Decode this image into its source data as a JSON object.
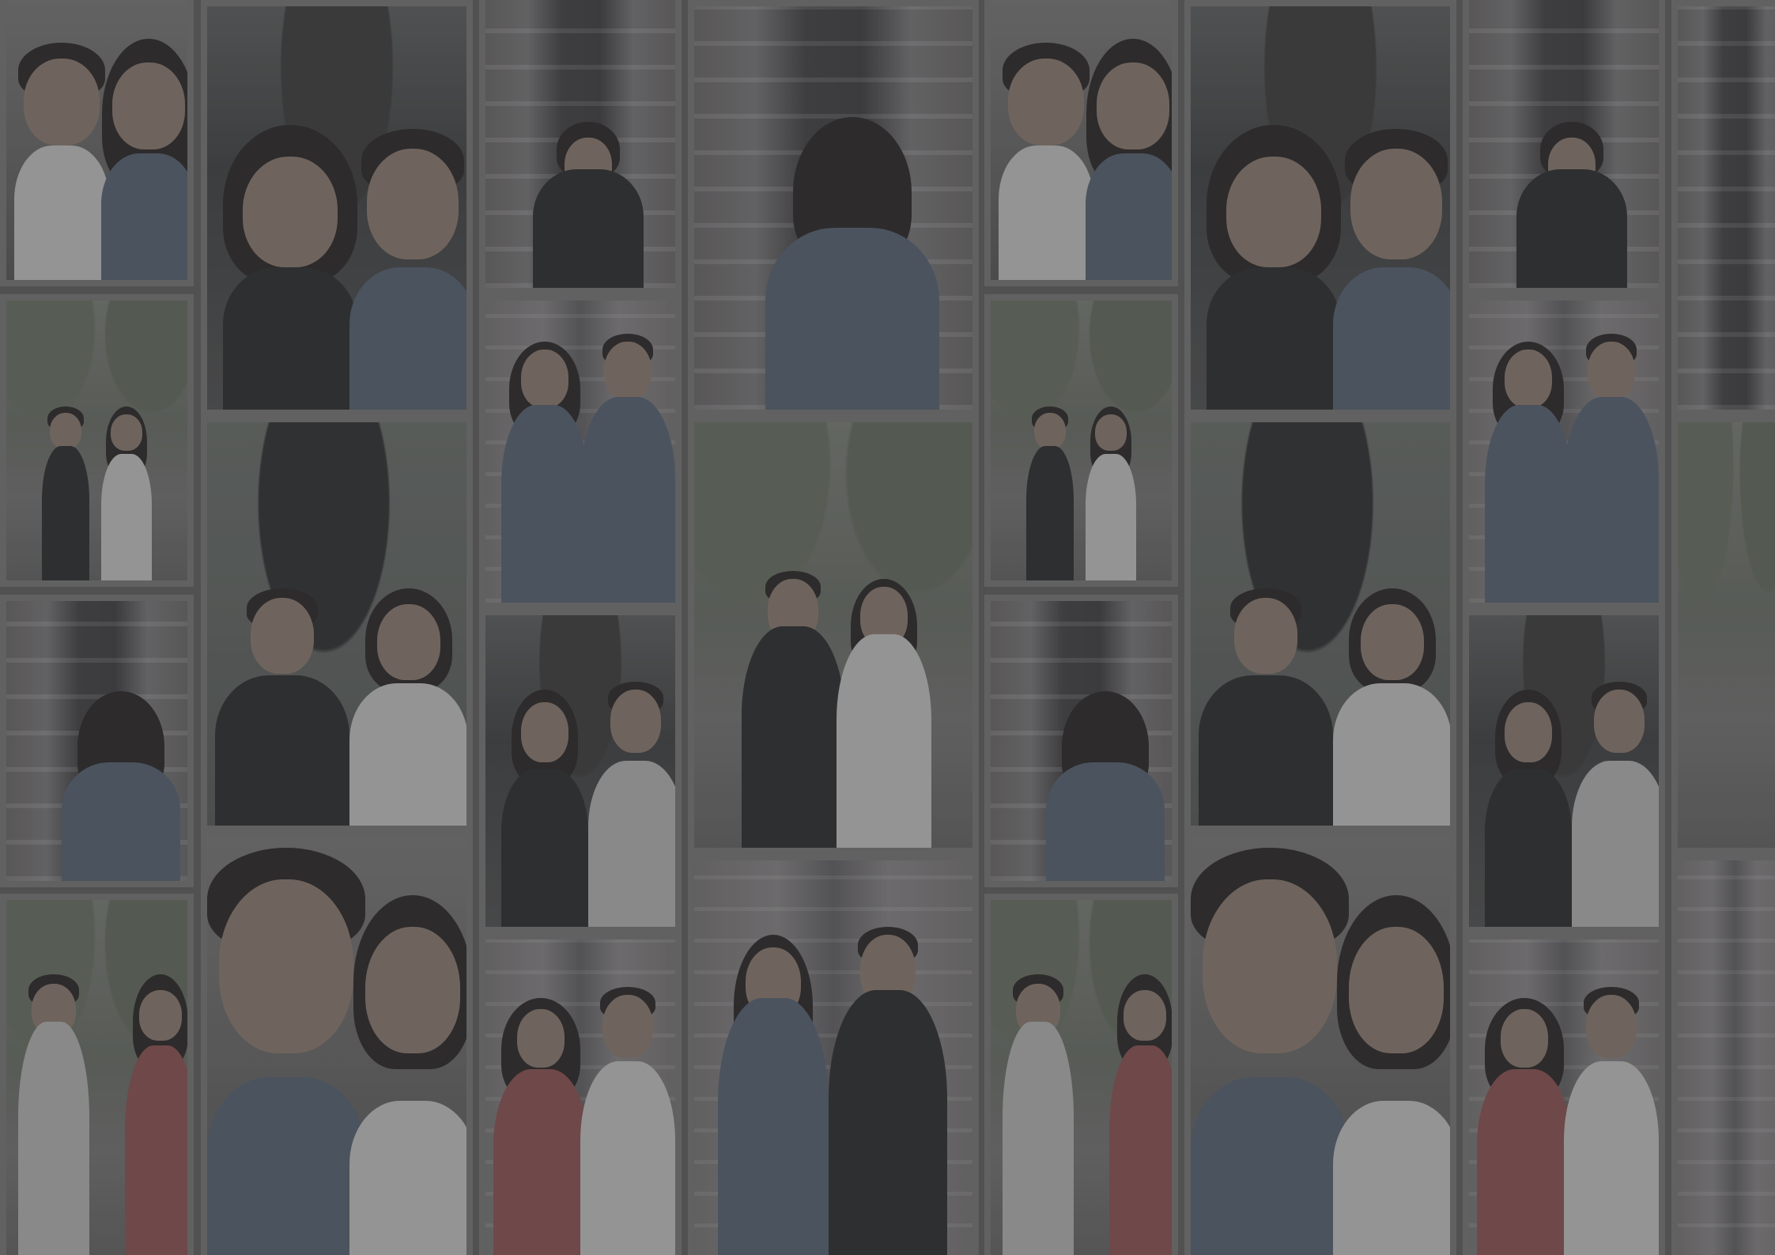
{
  "background": {
    "type": "photo-mosaic",
    "overlay_color": "#4a4a4a",
    "tile_border_color": "#6a6a6a"
  },
  "tiles": [
    {
      "name": "tile-selfie-couple-1",
      "scene": "selfie"
    },
    {
      "name": "tile-car-couple-1",
      "scene": "car"
    },
    {
      "name": "tile-store-boy-1",
      "scene": "store"
    },
    {
      "name": "tile-store-girl-back-1",
      "scene": "store"
    },
    {
      "name": "tile-park-couple-1",
      "scene": "park"
    },
    {
      "name": "tile-umbrella-couple-1",
      "scene": "umbrella"
    },
    {
      "name": "tile-store-couple-1",
      "scene": "store2"
    },
    {
      "name": "tile-park-couple-large-1",
      "scene": "park"
    },
    {
      "name": "tile-store-girl-back-2",
      "scene": "store"
    },
    {
      "name": "tile-car-couple-2",
      "scene": "car"
    },
    {
      "name": "tile-park-couple-2",
      "scene": "park"
    },
    {
      "name": "tile-selfie-couple-2",
      "scene": "selfie"
    },
    {
      "name": "tile-store-couple-2",
      "scene": "store2"
    },
    {
      "name": "tile-store-couple-3",
      "scene": "store2"
    }
  ]
}
